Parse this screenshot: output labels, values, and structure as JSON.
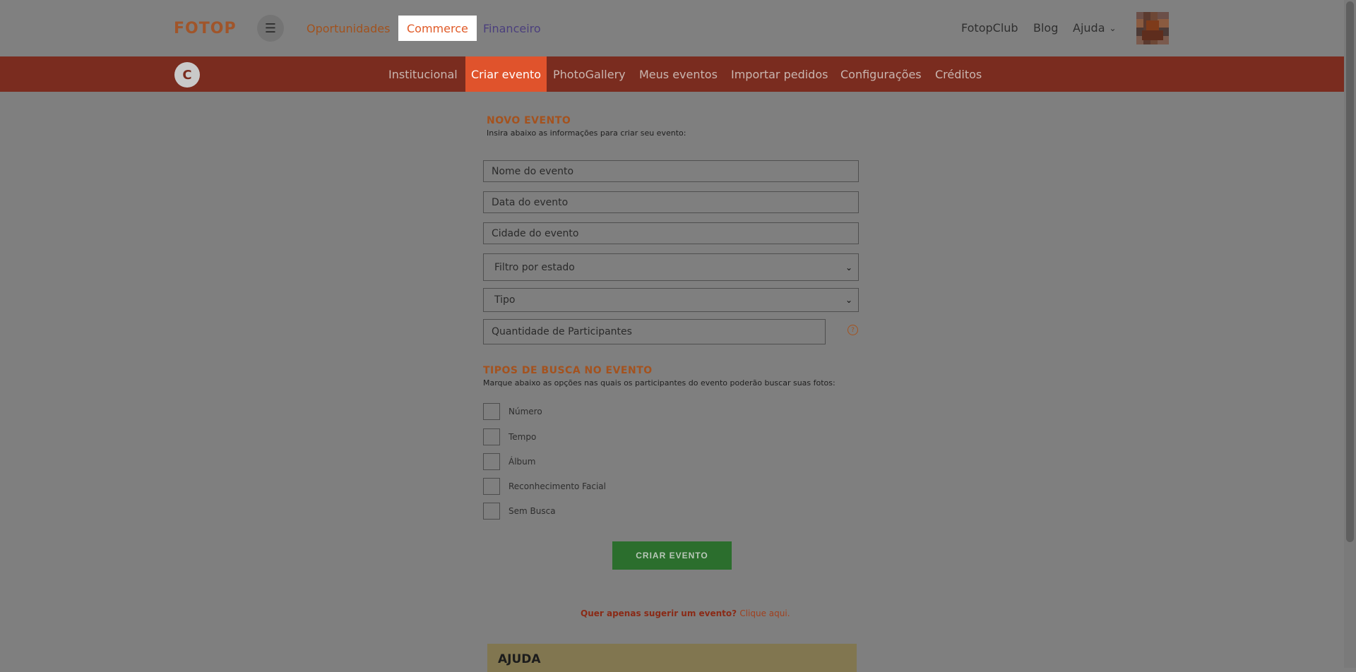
{
  "header": {
    "logo": "FOTOP",
    "menu_icon": "☰",
    "nav": {
      "oportunidades": "Oportunidades",
      "commerce": "Commerce",
      "financeiro": "Financeiro"
    },
    "right": {
      "fotopclub": "FotopClub",
      "blog": "Blog",
      "ajuda": "Ajuda",
      "chevron": "⌄"
    }
  },
  "subnav": {
    "avatar_letter": "C",
    "items": {
      "institucional": "Institucional",
      "criar_evento": "Criar evento",
      "photogallery": "PhotoGallery",
      "meus_eventos": "Meus eventos",
      "importar_pedidos": "Importar pedidos",
      "configuracoes": "Configurações",
      "creditos": "Créditos"
    }
  },
  "form": {
    "title": "NOVO EVENTO",
    "subtitle": "Insira abaixo as informações para criar seu evento:",
    "nome_placeholder": "Nome do evento",
    "data_placeholder": "Data do evento",
    "cidade_placeholder": "Cidade do evento",
    "estado_selected": "Filtro por estado",
    "tipo_selected": "Tipo",
    "participantes_placeholder": "Quantidade de Participantes",
    "help_symbol": "?",
    "dd_symbol": "⌄"
  },
  "busca": {
    "title": "TIPOS DE BUSCA NO EVENTO",
    "subtitle": "Marque abaixo as opções nas quais os participantes do evento poderão buscar suas fotos:",
    "options": [
      "Número",
      "Tempo",
      "Álbum",
      "Reconhecimento Facial",
      "Sem Busca"
    ]
  },
  "submit_label": "CRIAR EVENTO",
  "suggest": {
    "text": "Quer apenas sugerir um evento?",
    "link": "Clique aqui."
  },
  "ajuda_box": {
    "title": "AJUDA"
  }
}
